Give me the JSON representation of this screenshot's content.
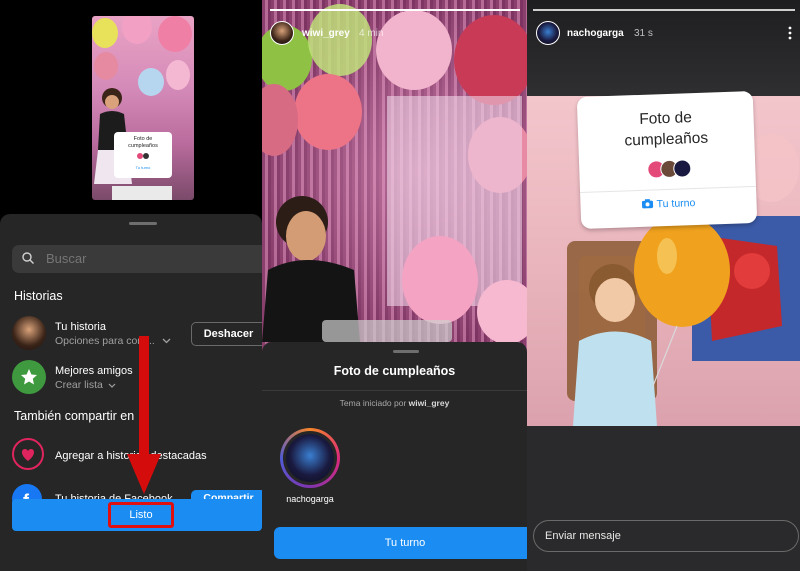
{
  "panel1": {
    "thumbnail": {
      "sticker_title": "Foto de cumpleaños",
      "sticker_button": "Tu turno"
    },
    "search": {
      "placeholder": "Buscar"
    },
    "stories_title": "Historias",
    "your_story": {
      "title": "Tu historia",
      "subtitle": "Opciones para com...",
      "undo_label": "Deshacer"
    },
    "close_friends": {
      "title": "Mejores amigos",
      "subtitle": "Crear lista"
    },
    "also_share_title": "También compartir en",
    "highlights": {
      "label": "Agregar a historias destacadas"
    },
    "facebook": {
      "label": "Tu historia de Facebook",
      "share_label": "Compartir"
    },
    "done_label": "Listo"
  },
  "panel2": {
    "username": "wiwi_grey",
    "time": "4 min",
    "sheet_title": "Foto de cumpleaños",
    "meta_prefix": "Tema iniciado por",
    "meta_user": "wiwi_grey",
    "participant_name": "nachogarga",
    "button_label": "Tu turno"
  },
  "panel3": {
    "username": "nachogarga",
    "time": "31 s",
    "sticker_title": "Foto de cumpleaños",
    "sticker_button": "Tu turno",
    "message_placeholder": "Enviar mensaje"
  },
  "colors": {
    "accent_blue": "#1a8cf2",
    "sheet_bg": "#262626",
    "highlight_red": "#e01010"
  }
}
